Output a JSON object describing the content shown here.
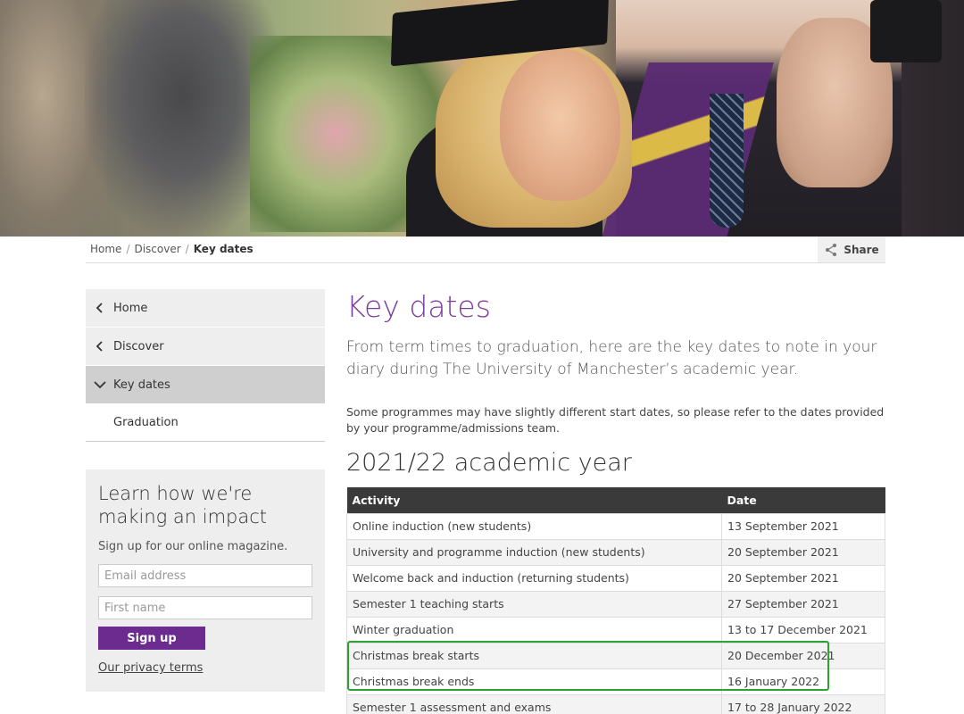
{
  "breadcrumb": {
    "items": [
      "Home",
      "Discover"
    ],
    "current": "Key dates"
  },
  "share": {
    "label": "Share",
    "icon": "share-icon"
  },
  "sidebar": {
    "items": [
      {
        "label": "Home",
        "icon": "chevron-left-icon"
      },
      {
        "label": "Discover",
        "icon": "chevron-left-icon"
      },
      {
        "label": "Key dates",
        "icon": "chevron-down-icon"
      }
    ],
    "sub": "Graduation"
  },
  "impact": {
    "title": "Learn how we're making an impact",
    "subtitle": "Sign up for our online magazine.",
    "email_placeholder": "Email address",
    "firstname_placeholder": "First name",
    "signup_label": "Sign up",
    "privacy_label": "Our privacy terms"
  },
  "main": {
    "title": "Key dates",
    "lead": "From term times to graduation, here are the key dates to note in your diary during The University of Manchester’s academic year.",
    "note": "Some programmes may have slightly different start dates, so please refer to the dates provided by your programme/admissions team.",
    "section_title": "2021/22 academic year"
  },
  "table": {
    "headers": [
      "Activity",
      "Date"
    ],
    "rows": [
      [
        "Online induction (new students)",
        "13 September 2021"
      ],
      [
        "University and programme induction (new students)",
        "20 September 2021"
      ],
      [
        "Welcome back and induction (returning students)",
        "20 September 2021"
      ],
      [
        "Semester 1 teaching starts",
        "27 September 2021"
      ],
      [
        "Winter graduation",
        "13 to 17 December 2021"
      ],
      [
        "Christmas break starts",
        "20 December 2021"
      ],
      [
        "Christmas break ends",
        "16 January 2022"
      ],
      [
        "Semester 1 assessment and exams",
        "17 to 28 January 2022"
      ]
    ]
  },
  "colors": {
    "accent_purple": "#7b3d9c",
    "button_purple": "#6b2b8f",
    "highlight_green": "#2da232",
    "table_header": "#3a3a3a"
  }
}
